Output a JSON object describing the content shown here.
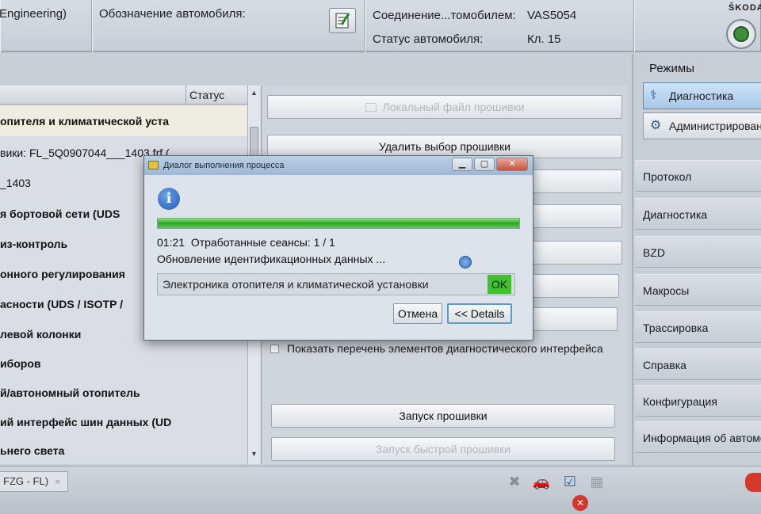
{
  "header": {
    "cell1_text": "Engineering)",
    "vehicle_label": "Обозначение автомобиля:",
    "connection_label": "Соединение...томобилем:",
    "connection_value": "VAS5054",
    "status_label": "Статус автомобиля:",
    "status_value": "Кл. 15",
    "brand": "ŠKODA"
  },
  "left_list": {
    "status_header": "Статус",
    "rows": [
      "опителя и климатической уста",
      "вики: FL_5Q0907044___1403.frf (",
      "_1403",
      "я бортовой сети (UDS",
      "из-контроль",
      "онного регулирования",
      "асности (UDS / ISOTP /",
      "левой колонки",
      "иборов",
      "й/автономный отопитель",
      "ий интерфейс шин данных (UD",
      "ьнего света"
    ]
  },
  "center": {
    "local_file_btn": "Локальный файл прошивки",
    "delete_selection_btn": "Удалить выбор прошивки",
    "show_list_checkbox": "Показать перечень элементов диагностического интерфейса",
    "start_flash_btn": "Запуск прошивки",
    "start_quick_flash_btn": "Запуск быстрой прошивки"
  },
  "sidebar": {
    "modes_title": "Режимы",
    "mode_buttons": [
      "Диагностика",
      "Администрирование"
    ],
    "nav_items": [
      "Протокол",
      "Диагностика",
      "BZD",
      "Макросы",
      "Трассировка",
      "Справка",
      "Конфигурация",
      "Информация об автомобиле"
    ],
    "next_symbol": "»"
  },
  "bottom": {
    "tab_label": "FZG - FL)"
  },
  "dialog": {
    "title": "Диалог выполнения процесса",
    "progress_fraction": 1.0,
    "elapsed": "01:21",
    "sessions_text": "Отработанные сеансы: 1 / 1",
    "current_step": "Обновление идентификационных данных ...",
    "ecu_name": "Электроника отопителя и климатической установки",
    "ecu_status": "OK",
    "cancel_btn": "Отмена",
    "details_btn": "<< Details"
  },
  "colors": {
    "progress_green": "#2ea32a",
    "ok_green": "#3fc12c",
    "active_mode_blue": "#a7c8e8"
  }
}
